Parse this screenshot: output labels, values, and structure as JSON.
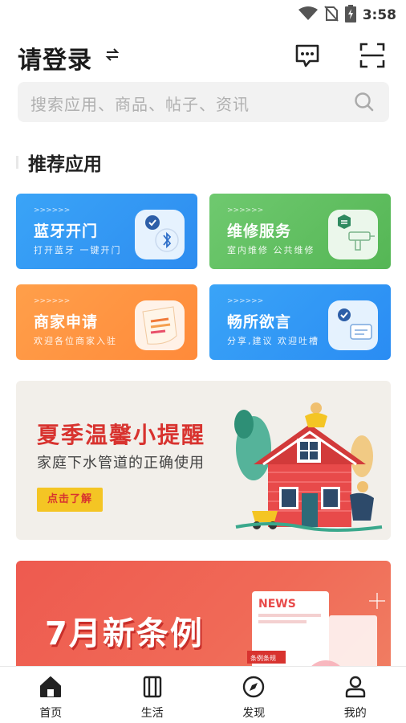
{
  "status_bar": {
    "time": "3:58",
    "icons": [
      "wifi-icon",
      "no-sim-icon",
      "battery-charging-icon"
    ]
  },
  "header": {
    "title": "请登录",
    "icons": [
      "switch-icon",
      "message-icon",
      "scan-icon"
    ]
  },
  "search": {
    "placeholder": "搜索应用、商品、帖子、资讯"
  },
  "section": {
    "title": "推荐应用"
  },
  "apps": [
    {
      "chevrons": ">>>>>>",
      "title": "蓝牙开门",
      "subtitle": "打开蓝牙 一键开门",
      "icon": "bluetooth-icon",
      "color": "#2d8cf0"
    },
    {
      "chevrons": ">>>>>>",
      "title": "维修服务",
      "subtitle": "室内维修 公共维修",
      "icon": "drill-icon",
      "color": "#55b655"
    },
    {
      "chevrons": ">>>>>>",
      "title": "商家申请",
      "subtitle": "欢迎各位商家入驻",
      "icon": "document-icon",
      "color": "#ff8a3a"
    },
    {
      "chevrons": ">>>>>>",
      "title": "畅所欲言",
      "subtitle": "分享,建议 欢迎吐槽",
      "icon": "chat-icon",
      "color": "#2a8cf3"
    }
  ],
  "banner1": {
    "title": "夏季温馨小提醒",
    "subtitle": "家庭下水管道的正确使用",
    "button": "点击了解"
  },
  "banner2": {
    "title": "7月新条例",
    "news_label": "NEWS",
    "tag": "条例条规"
  },
  "nav": [
    {
      "label": "首页",
      "icon": "home-icon",
      "active": true
    },
    {
      "label": "生活",
      "icon": "book-icon",
      "active": false
    },
    {
      "label": "发现",
      "icon": "compass-icon",
      "active": false
    },
    {
      "label": "我的",
      "icon": "user-icon",
      "active": false
    }
  ]
}
